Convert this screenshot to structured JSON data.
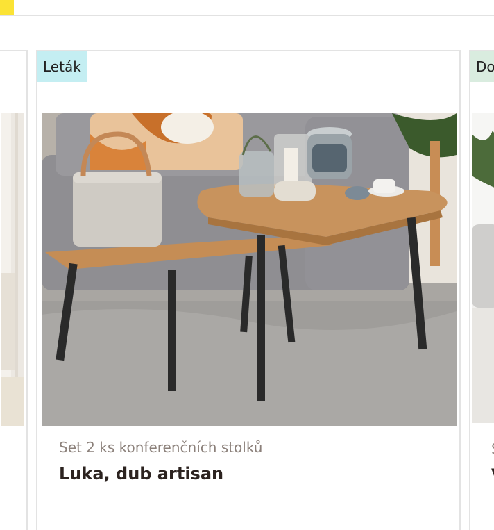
{
  "product_card": {
    "badge": "Leták",
    "subtitle": "Set 2 ks konferenčních stolků",
    "title": "Luka, dub artisan"
  },
  "next_card": {
    "badge": "Do",
    "subtitle": "S",
    "title": "V"
  }
}
